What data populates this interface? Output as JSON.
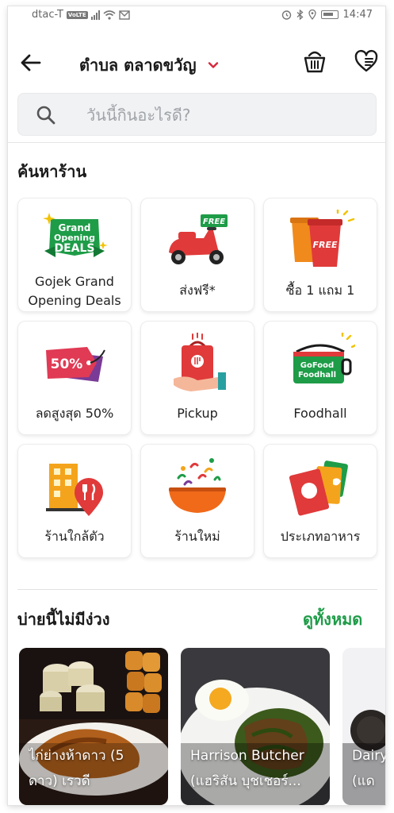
{
  "status_bar": {
    "carrier": "dtac-T",
    "volte": "VoLTE",
    "time": "14:47"
  },
  "header": {
    "title": "ตำบล ตลาดขวัญ"
  },
  "search": {
    "placeholder": "วันนี้กินอะไรดี?"
  },
  "find_section": {
    "title": "ค้นหาร้าน"
  },
  "categories": [
    {
      "label_line1": "Gojek Grand",
      "label_line2": "Opening Deals",
      "icon": "grand-opening-deals-icon",
      "badge_line1": "Grand",
      "badge_line2": "Opening",
      "badge_line3": "DEALS"
    },
    {
      "label": "ส่งฟรี*",
      "icon": "free-delivery-scooter-icon",
      "badge": "FREE"
    },
    {
      "label": "ซื้อ 1 แถม 1",
      "icon": "buy-one-get-one-cups-icon",
      "badge": "FREE"
    },
    {
      "label": "ลดสูงสุด 50%",
      "icon": "discount-tag-icon",
      "badge": "50%"
    },
    {
      "label": "Pickup",
      "icon": "pickup-bag-icon"
    },
    {
      "label": "Foodhall",
      "icon": "foodhall-bag-icon",
      "badge_line1": "GoFood",
      "badge_line2": "Foodhall"
    },
    {
      "label": "ร้านใกล้ตัว",
      "icon": "nearby-restaurant-icon"
    },
    {
      "label": "ร้านใหม่",
      "icon": "new-restaurant-bowl-icon"
    },
    {
      "label": "ประเภทอาหาร",
      "icon": "cuisine-menu-icon"
    }
  ],
  "afternoon_section": {
    "title": "บ่ายนี้ไม่มีง่วง",
    "see_all": "ดูทั้งหมด"
  },
  "restaurants": [
    {
      "name_line1": "ไก่ย่างห้าดาว (5",
      "name_line2": "ดาว) เรวดี"
    },
    {
      "name_line1": "Harrison Butcher",
      "name_line2": "(แฮริสัน บุชเชอร์..."
    },
    {
      "name_line1": "Dairy",
      "name_line2": "(แด"
    }
  ],
  "colors": {
    "brand_green": "#1e9c48",
    "accent_red": "#d6283a"
  }
}
